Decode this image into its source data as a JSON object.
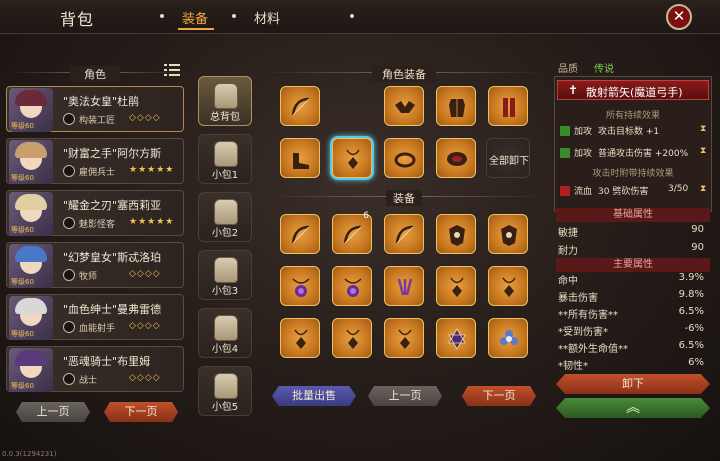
{
  "header": {
    "title": "背包",
    "tabs": [
      {
        "label": "装备",
        "active": true
      },
      {
        "label": "材料",
        "active": false
      }
    ],
    "close_icon": "close-icon"
  },
  "characters_section": {
    "title": "角色",
    "filter_icon": "list-filter-icon",
    "characters": [
      {
        "name": "\"奥法女皇\"杜鹃",
        "class": "构装工匠",
        "level": "等级60",
        "stars": "◇◇◇◇",
        "hair": "#6a2a3a"
      },
      {
        "name": "\"财富之手\"阿尔方斯",
        "class": "雇佣兵士",
        "level": "等级60",
        "stars": "★★★★★",
        "hair": "#c8a070"
      },
      {
        "name": "\"耀金之刃\"塞西莉亚",
        "class": "魅影怪客",
        "level": "等级60",
        "stars": "★★★★★",
        "hair": "#e0d0a0"
      },
      {
        "name": "\"幻梦皇女\"斯忒洛珀",
        "class": "牧师",
        "level": "等级60",
        "stars": "◇◇◇◇",
        "hair": "#4a78c8"
      },
      {
        "name": "\"血色绅士\"曼弗雷德",
        "class": "血能射手",
        "level": "等级60",
        "stars": "◇◇◇◇",
        "hair": "#d8d8d8"
      },
      {
        "name": "\"恶魂骑士\"布里姆",
        "class": "战士",
        "level": "等级60",
        "stars": "◇◇◇◇",
        "hair": "#5a3a7a"
      }
    ],
    "prev_page": "上一页",
    "next_page": "下一页"
  },
  "bags": [
    {
      "label": "总背包",
      "selected": true
    },
    {
      "label": "小包1",
      "selected": false
    },
    {
      "label": "小包2",
      "selected": false
    },
    {
      "label": "小包3",
      "selected": false
    },
    {
      "label": "小包4",
      "selected": false
    },
    {
      "label": "小包5",
      "selected": false
    }
  ],
  "char_equipment": {
    "title": "角色装备",
    "unequip_all": "全部卸下"
  },
  "inventory": {
    "title": "装备",
    "badge": "6",
    "bulk_sell": "批量出售",
    "prev_page": "上一页",
    "next_page": "下一页"
  },
  "item_detail": {
    "quality_label": "品质",
    "quality_value": "传说",
    "item_name": "散射箭矢(魔道弓手)",
    "passive_title": "所有持续效果",
    "effects": [
      {
        "tag": "加攻",
        "text": "攻击目标数 +1",
        "icon": "hourglass-icon"
      },
      {
        "tag": "加攻",
        "text": "普通攻击伤害 +200%",
        "icon": "hourglass-icon"
      }
    ],
    "attack_title": "攻击时附带持续效果",
    "bleed": {
      "tag": "流血",
      "text": "30 劈砍伤害",
      "count": "3/50"
    },
    "basic_title": "基础属性",
    "basic_stats": [
      {
        "name": "敏捷",
        "value": "90"
      },
      {
        "name": "耐力",
        "value": "90"
      }
    ],
    "main_title": "主要属性",
    "main_stats": [
      {
        "name": "命中",
        "value": "3.9%"
      },
      {
        "name": "暴击伤害",
        "value": "9.8%"
      },
      {
        "name": "**所有伤害**",
        "value": "6.5%"
      },
      {
        "name": "*受到伤害*",
        "value": "-6%"
      },
      {
        "name": "**额外生命值**",
        "value": "6.5%"
      },
      {
        "name": "*韧性*",
        "value": "6%"
      }
    ],
    "unequip_button": "卸下"
  },
  "version": "0.0.3(1294231)",
  "colors": {
    "accent": "#f0a840",
    "legendary": "#7ad04a",
    "slot_gold": "#e8a040",
    "selection": "#58c8e8"
  }
}
